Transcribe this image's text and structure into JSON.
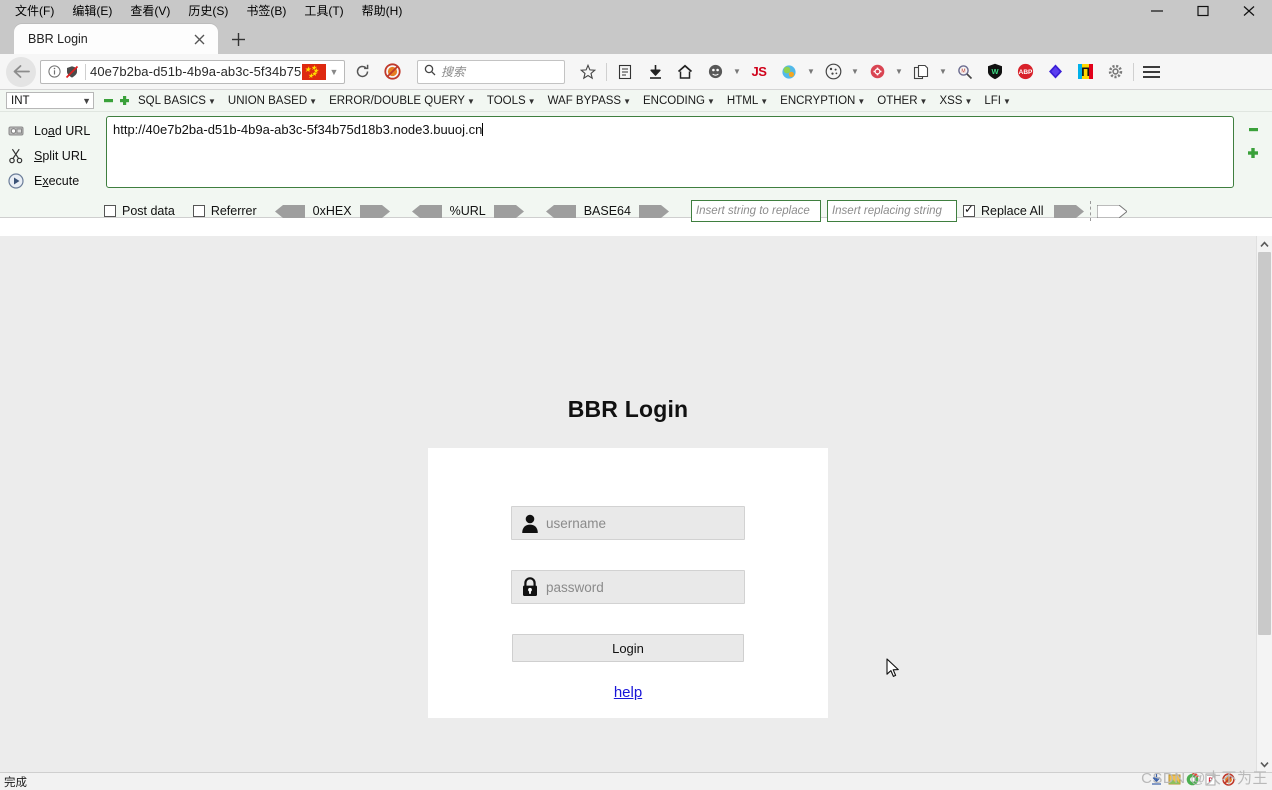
{
  "window": {
    "menus": [
      {
        "label": "文件(F)",
        "mnemonic": "F"
      },
      {
        "label": "编辑(E)",
        "mnemonic": "E"
      },
      {
        "label": "查看(V)",
        "mnemonic": "V"
      },
      {
        "label": "历史(S)",
        "mnemonic": "S"
      },
      {
        "label": "书签(B)",
        "mnemonic": "B"
      },
      {
        "label": "工具(T)",
        "mnemonic": "T"
      },
      {
        "label": "帮助(H)",
        "mnemonic": "H"
      }
    ],
    "controls": {
      "minimize": "minimize-icon",
      "maximize": "maximize-icon",
      "close": "close-icon"
    }
  },
  "tabs": {
    "active": {
      "title": "BBR Login",
      "close_icon": "close-icon"
    },
    "new_tab_icon": "plus-icon"
  },
  "navbar": {
    "back_icon": "back-arrow-icon",
    "info_icon": "info-icon",
    "shield_icon": "shield-disabled-icon",
    "url_value": "40e7b2ba-d51b-4b9a-ab3c-5f34b75",
    "flag_icon": "china-flag-icon",
    "dropdown_icon": "chevron-down-icon",
    "reload_icon": "reload-icon",
    "search_placeholder": "搜索",
    "search_icon": "search-icon",
    "icons": [
      {
        "name": "bookmark-star-icon",
        "glyph": "☆"
      },
      {
        "name": "reading-list-icon",
        "glyph": "▤"
      },
      {
        "name": "downloads-icon",
        "glyph": "⬇"
      },
      {
        "name": "home-icon",
        "glyph": "⌂"
      },
      {
        "name": "profile-icon",
        "glyph": "●"
      },
      {
        "name": "javascript-toggle-icon",
        "glyph": "JS"
      },
      {
        "name": "chameleon-icon",
        "glyph": "◕"
      },
      {
        "name": "cookie-manager-icon",
        "glyph": "◍"
      },
      {
        "name": "redirector-icon",
        "glyph": "◉"
      },
      {
        "name": "copy-page-icon",
        "glyph": "❐"
      },
      {
        "name": "zoom-search-icon",
        "glyph": "⌕"
      },
      {
        "name": "wappalyzer-icon",
        "glyph": "W"
      },
      {
        "name": "adblock-plus-icon",
        "glyph": "ABP"
      },
      {
        "name": "violentmonkey-icon",
        "glyph": "◆"
      },
      {
        "name": "proxy-switcher-icon",
        "glyph": "П"
      },
      {
        "name": "settings-gear-icon",
        "glyph": "⚙"
      }
    ],
    "menu_icon": "hamburger-menu-icon"
  },
  "hackbar": {
    "type_select": {
      "value": "INT",
      "caret": "▾"
    },
    "minus_icon": "minus-icon",
    "plus_icon": "plus-icon",
    "menus": [
      {
        "label": "SQL BASICS",
        "caret": "▾"
      },
      {
        "label": "UNION BASED",
        "caret": "▾"
      },
      {
        "label": "ERROR/DOUBLE QUERY",
        "caret": "▾"
      },
      {
        "label": "TOOLS",
        "caret": "▾"
      },
      {
        "label": "WAF BYPASS",
        "caret": "▾"
      },
      {
        "label": "ENCODING",
        "caret": "▾"
      },
      {
        "label": "HTML",
        "caret": "▾"
      },
      {
        "label": "ENCRYPTION",
        "caret": "▾"
      },
      {
        "label": "OTHER",
        "caret": "▾"
      },
      {
        "label": "XSS",
        "caret": "▾"
      },
      {
        "label": "LFI",
        "caret": "▾"
      }
    ],
    "actions": [
      {
        "label_pre": "Lo",
        "label_key": "a",
        "label_post": "d URL",
        "icon": "load-url-icon"
      },
      {
        "label_pre": "",
        "label_key": "S",
        "label_post": "plit URL",
        "icon": "split-url-icon"
      },
      {
        "label_pre": "E",
        "label_key": "x",
        "label_post": "ecute",
        "icon": "execute-icon"
      }
    ],
    "url_value": "http://40e7b2ba-d51b-4b9a-ab3c-5f34b75d18b3.node3.buuoj.cn",
    "options": {
      "post_data_label": "Post data",
      "post_data_checked": false,
      "referrer_label": "Referrer",
      "referrer_checked": false
    },
    "encoders": [
      {
        "label": "0xHEX"
      },
      {
        "label": "%URL"
      },
      {
        "label": "BASE64"
      }
    ],
    "replace_from_placeholder": "Insert string to replace",
    "replace_to_placeholder": "Insert replacing string",
    "replace_all_label": "Replace All",
    "replace_all_checked": true
  },
  "page": {
    "title": "BBR Login",
    "username": {
      "placeholder": "username",
      "icon": "user-icon"
    },
    "password": {
      "placeholder": "password",
      "icon": "lock-icon"
    },
    "login_button": "Login",
    "help_link": "help"
  },
  "scrollbar": {
    "up_icon": "chevron-up-icon",
    "down_icon": "chevron-down-icon"
  },
  "statusbar": {
    "text": "完成",
    "watermark": "CSDN @大不为王"
  },
  "colors": {
    "chrome_bg": "#c8c8c8",
    "hackbar_bg": "#f2f7f2",
    "hackbar_border": "#3f7f3f",
    "page_bg": "#ececec",
    "card_bg": "#ffffff",
    "link": "#1a16d8",
    "flag_red": "#de2910"
  }
}
